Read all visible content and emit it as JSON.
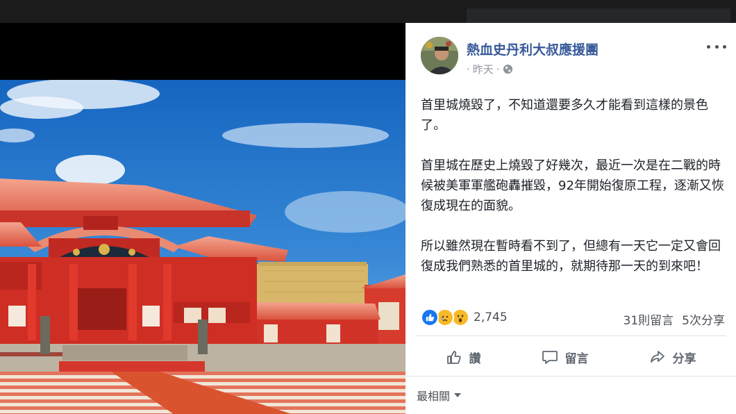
{
  "post": {
    "page_name": "熱血史丹利大叔應援團",
    "time": "昨天",
    "dot": "·",
    "paragraphs": [
      "首里城燒毀了，不知道還要多久才能看到這樣的景色了。",
      "首里城在歷史上燒毀了好幾次，最近一次是在二戰的時候被美軍軍艦砲轟摧毀，92年開始復原工程，逐漸又恢復成現在的面貌。",
      "所以雖然現在暫時看不到了，但總有一天它一定又會回復成我們熟悉的首里城的，就期待那一天的到來吧！"
    ]
  },
  "engagement": {
    "reaction_count": "2,745",
    "comments": "31則留言",
    "shares": "5次分享"
  },
  "actions": {
    "like": "讚",
    "comment": "留言",
    "share": "分享"
  },
  "sort": {
    "label": "最相關"
  },
  "colors": {
    "link": "#365899",
    "text": "#1d2129",
    "muted": "#90949c",
    "like_blue": "#1877f2",
    "reaction_yellow": "#f7b928"
  },
  "icons": {
    "more": "more-dots-icon",
    "globe": "globe-icon",
    "like": "thumbs-up-icon",
    "comment": "speech-bubble-icon",
    "share": "share-arrow-icon"
  }
}
